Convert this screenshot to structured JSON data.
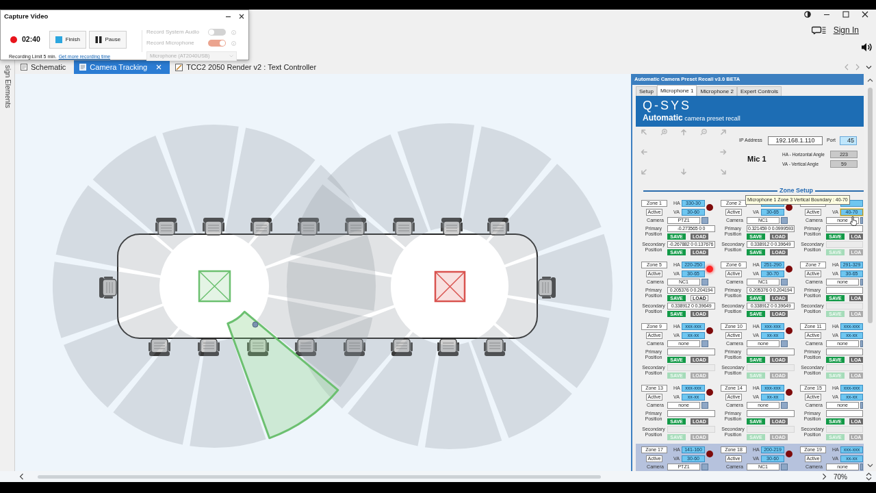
{
  "capture_window": {
    "title": "Capture Video",
    "recording": true,
    "timer": "02:40",
    "finish": "Finish",
    "pause": "Pause",
    "limit": "Recording Limit 5 min.",
    "link": "Get more recording time",
    "audio_disabled": true,
    "audio_options": [
      {
        "label": "Record System Audio",
        "on": false
      },
      {
        "label": "Record Microphone",
        "on": true
      }
    ],
    "microphone": "Microphone (AT2040USB)"
  },
  "header": {
    "sign_in": "Sign In"
  },
  "side_panel": {
    "label": "sign Elements"
  },
  "tabs": [
    {
      "label": "Schematic",
      "selected": false,
      "closable": false
    },
    {
      "label": "Camera Tracking",
      "selected": true,
      "closable": true
    },
    {
      "label": "TCC2 2050 Render v2 : Text Controller",
      "selected": false,
      "closable": false
    }
  ],
  "canvas": {
    "cameras": [
      {
        "color": "#6cc070"
      },
      {
        "color": "#d9534f"
      }
    ],
    "selected_sector": true
  },
  "panel": {
    "title": "Automatic Camera Preset Recall v3.0 BETA",
    "tabs": [
      {
        "label": "Setup",
        "selected": false
      },
      {
        "label": "Microphone 1",
        "selected": true
      },
      {
        "label": "Microphone 2",
        "selected": false
      },
      {
        "label": "Expert Controls",
        "selected": false
      }
    ],
    "banner": {
      "logo": "Q-SYS",
      "subtitle": "**Automatic** camera preset recall"
    },
    "ip_label": "IP Address",
    "ip": "192.168.1.110",
    "port_label": "Port",
    "port": "45",
    "mic": "Mic 1",
    "angles": [
      {
        "label": "HA - Horizontal Angle",
        "value": "223"
      },
      {
        "label": "VA - Vertical Angle",
        "value": "59"
      }
    ],
    "zone_setup": "Zone Setup",
    "tooltip": "Microphone 1 Zone 3 Vertical Boundary : 40-70",
    "zone_rows": [
      {
        "selected": false,
        "zones": [
          {
            "name": "Zone 1",
            "ha_label": "HA",
            "ha": "330-30",
            "active": "Active",
            "va_label": "VA",
            "va": "30-60",
            "va_hover": false,
            "led_on": false,
            "camera_label": "Camera",
            "camera": "PTZ1",
            "positions": [
              {
                "label": "Primary Position",
                "value": "-0.273565 0 0",
                "enabled": true,
                "save": "SAVE",
                "load": "LOAD",
                "load_lit": false
              },
              {
                "label": "Secondary Position",
                "value": "-0.267882 0 0.137676",
                "enabled": true,
                "save": "SAVE",
                "load": "LOAD",
                "load_lit": false
              }
            ]
          },
          {
            "name": "Zone 2",
            "active": "Active",
            "va_label": "VA",
            "va": "30-65",
            "va_hover": false,
            "led_on": false,
            "camera_label": "Camera",
            "camera": "NC1",
            "positions": [
              {
                "label": "Primary Position",
                "value": "0.321459 0 0.0999593",
                "enabled": true,
                "save": "SAVE",
                "load": "LOAD",
                "load_lit": false
              },
              {
                "label": "Secondary Position",
                "value": "0.338912 0 0.39649",
                "enabled": true,
                "save": "SAVE",
                "load": "LOAD",
                "load_lit": false
              }
            ]
          },
          {
            "active": "Active",
            "va_label": "VA",
            "va": "40-70",
            "va_hover": true,
            "camera_label": "Camera",
            "camera": "none",
            "positions": [
              {
                "label": "Primary Position",
                "enabled": true,
                "save": "SAVE",
                "load": "LOA",
                "load_lit": false
              },
              {
                "label": "Secondary Position",
                "enabled": false,
                "save": "SAVE",
                "load": "LOA",
                "load_lit": false
              }
            ]
          }
        ]
      },
      {
        "selected": false,
        "zones": [
          {
            "name": "Zone 5",
            "ha_label": "HA",
            "ha": "220-250",
            "active": "Active",
            "va_label": "VA",
            "va": "30-65",
            "va_hover": false,
            "led_on": true,
            "camera_label": "Camera",
            "camera": "NC1",
            "positions": [
              {
                "label": "Primary Position",
                "value": "0.205376 0 0.204194",
                "enabled": true,
                "save": "SAVE",
                "load": "LOAD",
                "load_lit": true
              },
              {
                "label": "Secondary Position",
                "value": "0.338912 0 0.39649",
                "enabled": true,
                "save": "SAVE",
                "load": "LOAD",
                "load_lit": false
              }
            ]
          },
          {
            "name": "Zone 6",
            "ha_label": "HA",
            "ha": "251-290",
            "active": "Active",
            "va_label": "VA",
            "va": "30-70",
            "va_hover": false,
            "led_on": false,
            "camera_label": "Camera",
            "camera": "NC1",
            "positions": [
              {
                "label": "Primary Position",
                "value": "0.205376 0 0.204194",
                "enabled": true,
                "save": "SAVE",
                "load": "LOAD",
                "load_lit": false
              },
              {
                "label": "Secondary Position",
                "value": "0.338912 0 0.39649",
                "enabled": true,
                "save": "SAVE",
                "load": "LOAD",
                "load_lit": false
              }
            ]
          },
          {
            "name": "Zone 7",
            "ha_label": "HA",
            "ha": "291-329",
            "active": "Active",
            "va_label": "VA",
            "va": "30-65",
            "va_hover": false,
            "camera_label": "Camera",
            "camera": "none",
            "positions": [
              {
                "label": "Primary Position",
                "enabled": true,
                "save": "SAVE",
                "load": "LOA",
                "load_lit": false
              },
              {
                "label": "Secondary Position",
                "enabled": false,
                "save": "SAVE",
                "load": "LOA",
                "load_lit": false
              }
            ]
          }
        ]
      },
      {
        "selected": false,
        "zones": [
          {
            "name": "Zone 9",
            "ha_label": "HA",
            "ha": "xxx-xxx",
            "active": "Active",
            "va_label": "VA",
            "va": "xx-xx",
            "va_hover": false,
            "led_on": false,
            "camera_label": "Camera",
            "camera": "none",
            "positions": [
              {
                "label": "Primary Position",
                "enabled": true,
                "save": "SAVE",
                "load": "LOAD",
                "load_lit": false
              },
              {
                "label": "Secondary Position",
                "enabled": false,
                "save": "SAVE",
                "load": "LOAD",
                "load_lit": false
              }
            ]
          },
          {
            "name": "Zone 10",
            "ha_label": "HA",
            "ha": "xxx-xxx",
            "active": "Active",
            "va_label": "VA",
            "va": "xx-xx",
            "va_hover": false,
            "led_on": false,
            "camera_label": "Camera",
            "camera": "none",
            "positions": [
              {
                "label": "Primary Position",
                "enabled": true,
                "save": "SAVE",
                "load": "LOAD",
                "load_lit": false
              },
              {
                "label": "Secondary Position",
                "enabled": false,
                "save": "SAVE",
                "load": "LOAD",
                "load_lit": false
              }
            ]
          },
          {
            "name": "Zone 11",
            "ha_label": "HA",
            "ha": "xxx-xxx",
            "active": "Active",
            "va_label": "VA",
            "va": "xx-xx",
            "va_hover": false,
            "camera_label": "Camera",
            "camera": "none",
            "positions": [
              {
                "label": "Primary Position",
                "enabled": true,
                "save": "SAVE",
                "load": "LOA",
                "load_lit": false
              },
              {
                "label": "Secondary Position",
                "enabled": false,
                "save": "SAVE",
                "load": "LOA",
                "load_lit": false
              }
            ]
          }
        ]
      },
      {
        "selected": false,
        "zones": [
          {
            "name": "Zone 13",
            "ha_label": "HA",
            "ha": "xxx-xxx",
            "active": "Active",
            "va_label": "VA",
            "va": "xx-xx",
            "va_hover": false,
            "led_on": false,
            "camera_label": "Camera",
            "camera": "none",
            "positions": [
              {
                "label": "Primary Position",
                "enabled": true,
                "save": "SAVE",
                "load": "LOAD",
                "load_lit": false
              },
              {
                "label": "Secondary Position",
                "enabled": false,
                "save": "SAVE",
                "load": "LOAD",
                "load_lit": false
              }
            ]
          },
          {
            "name": "Zone 14",
            "ha_label": "HA",
            "ha": "xxx-xxx",
            "active": "Active",
            "va_label": "VA",
            "va": "xx-xx",
            "va_hover": false,
            "led_on": false,
            "camera_label": "Camera",
            "camera": "none",
            "positions": [
              {
                "label": "Primary Position",
                "enabled": true,
                "save": "SAVE",
                "load": "LOAD",
                "load_lit": false
              },
              {
                "label": "Secondary Position",
                "enabled": false,
                "save": "SAVE",
                "load": "LOAD",
                "load_lit": false
              }
            ]
          },
          {
            "name": "Zone 15",
            "ha_label": "HA",
            "ha": "xxx-xxx",
            "active": "Active",
            "va_label": "VA",
            "va": "xx-xx",
            "va_hover": false,
            "camera_label": "Camera",
            "camera": "none",
            "positions": [
              {
                "label": "Primary Position",
                "enabled": true,
                "save": "SAVE",
                "load": "LOA",
                "load_lit": false
              },
              {
                "label": "Secondary Position",
                "enabled": false,
                "save": "SAVE",
                "load": "LOA",
                "load_lit": false
              }
            ]
          }
        ]
      },
      {
        "selected": true,
        "zones": [
          {
            "name": "Zone 17",
            "ha_label": "HA",
            "ha": "141-160",
            "active": "Active",
            "va_label": "VA",
            "va": "30-60",
            "va_hover": false,
            "led_on": false,
            "camera_label": "Camera",
            "camera": "PTZ1"
          },
          {
            "name": "Zone 18",
            "ha_label": "HA",
            "ha": "200-219",
            "active": "Active",
            "va_label": "VA",
            "va": "30-60",
            "va_hover": false,
            "led_on": false,
            "camera_label": "Camera",
            "camera": "NC1"
          },
          {
            "name": "Zone 19",
            "ha_label": "HA",
            "ha": "xxx-xxx",
            "active": "Active",
            "va_label": "VA",
            "va": "xx-xx",
            "va_hover": false,
            "camera_label": "Camera",
            "camera": "none"
          }
        ]
      }
    ]
  },
  "status_bar": {
    "zoom": "70%"
  }
}
